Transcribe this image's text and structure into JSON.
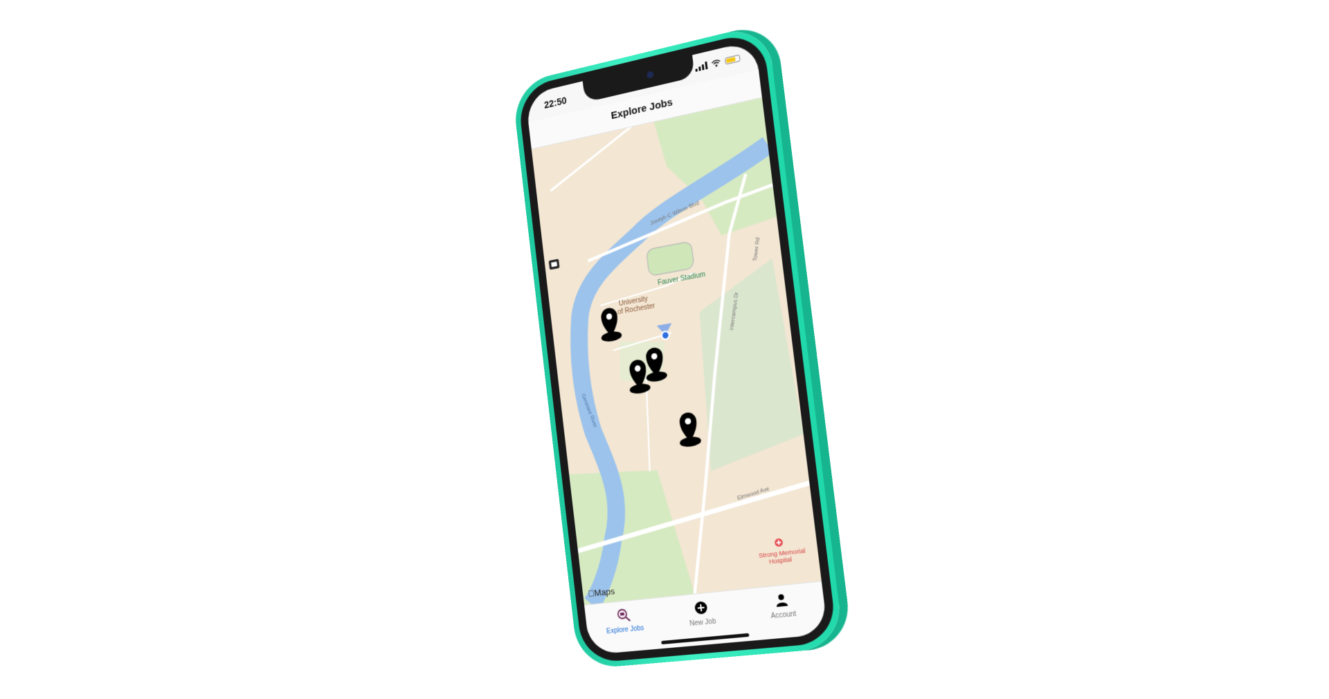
{
  "status_bar": {
    "time": "22:50"
  },
  "nav": {
    "title": "Explore Jobs"
  },
  "map": {
    "attribution": "Maps",
    "labels": {
      "university": "University\nof Rochester",
      "stadium": "Fauver Stadium",
      "river": "Genesee River",
      "hospital": "Strong Memorial\nHospital",
      "road_wilson": "Joseph C Wilson Blvd",
      "road_elmwood": "Elmwood Ave",
      "road_intercampus": "Intercampus Dr",
      "road_tower": "Tower Rd"
    },
    "pins_count": 4,
    "user_location_icon": "user-location-dot"
  },
  "tabs": [
    {
      "label": "Explore Jobs",
      "icon": "explore-jobs-icon",
      "active": true
    },
    {
      "label": "New Job",
      "icon": "plus-circle-icon",
      "active": false
    },
    {
      "label": "Account",
      "icon": "person-icon",
      "active": false
    }
  ],
  "colors": {
    "frame": "#2fe0b5",
    "accent": "#1e6fd6",
    "water": "#a9cbf0",
    "park": "#cfe6b9"
  }
}
